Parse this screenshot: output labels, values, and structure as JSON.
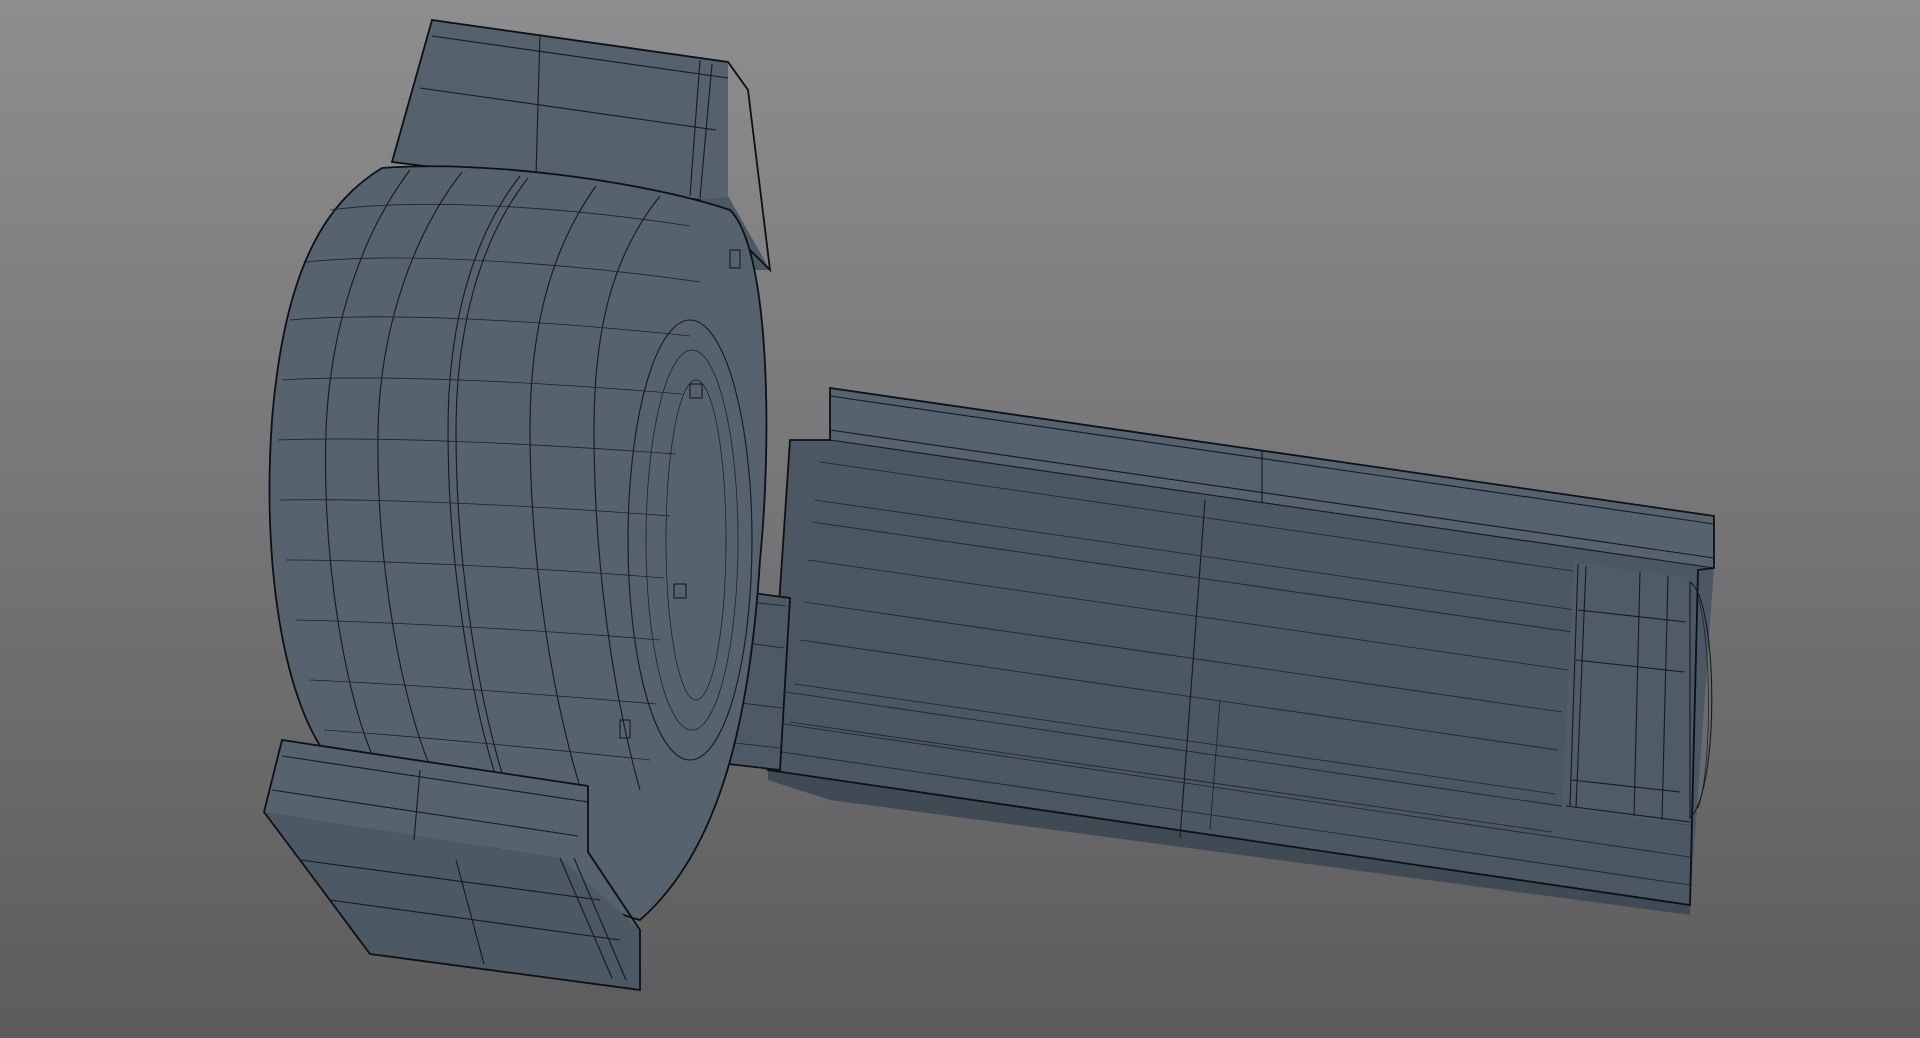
{
  "viewport": {
    "mode": "wireframe-on-shaded",
    "background_top": "#8c8c8c",
    "background_bottom": "#5e5e5e",
    "model_fill": "#4e5a66",
    "model_fill_light": "#5a6672",
    "model_fill_dark": "#434e59",
    "wire_color": "#151a1f"
  },
  "model": {
    "description_visible": false,
    "parts": [
      "wheel",
      "top-bracket",
      "bottom-bracket",
      "axle",
      "housing",
      "end-cap"
    ]
  }
}
